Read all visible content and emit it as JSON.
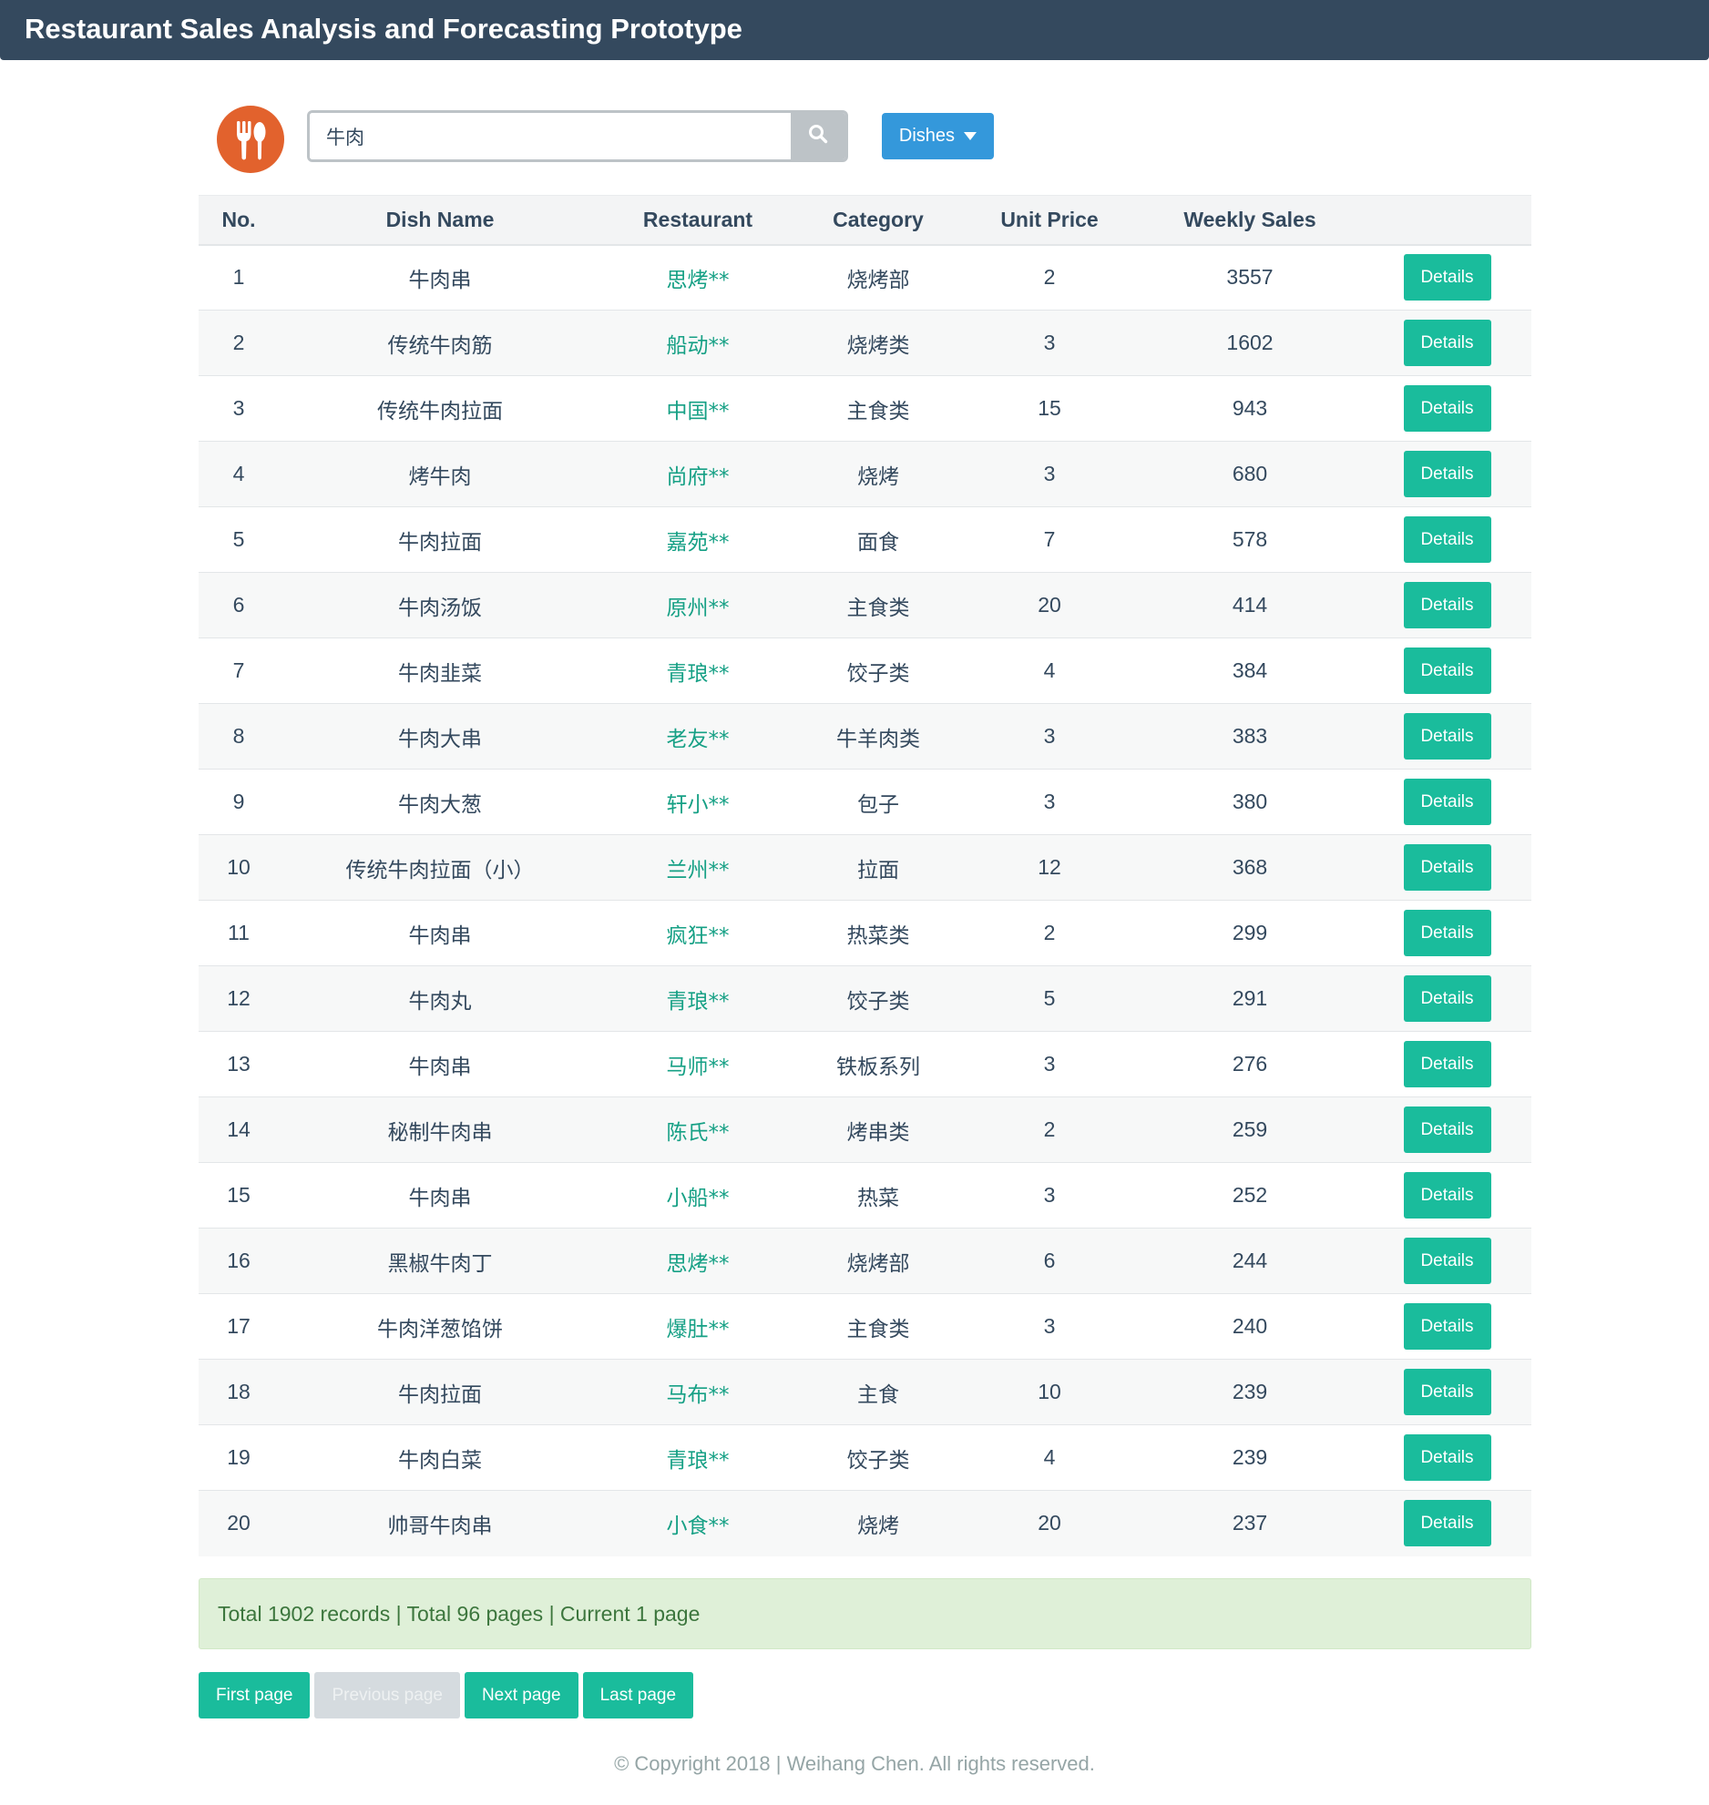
{
  "header": {
    "title": "Restaurant Sales Analysis and Forecasting Prototype"
  },
  "logo": {
    "icon": "fork-spoon-icon",
    "color": "#e2622d"
  },
  "search": {
    "value": "牛肉",
    "icon": "search-icon"
  },
  "filter": {
    "label": "Dishes",
    "icon": "caret-down-icon"
  },
  "table": {
    "columns": [
      "No.",
      "Dish Name",
      "Restaurant",
      "Category",
      "Unit Price",
      "Weekly Sales",
      ""
    ],
    "details_label": "Details",
    "rows": [
      {
        "no": "1",
        "dish": "牛肉串",
        "restaurant": "思烤**",
        "category": "烧烤部",
        "price": "2",
        "sales": "3557"
      },
      {
        "no": "2",
        "dish": "传统牛肉筋",
        "restaurant": "船动**",
        "category": "烧烤类",
        "price": "3",
        "sales": "1602"
      },
      {
        "no": "3",
        "dish": "传统牛肉拉面",
        "restaurant": "中国**",
        "category": "主食类",
        "price": "15",
        "sales": "943"
      },
      {
        "no": "4",
        "dish": "烤牛肉",
        "restaurant": "尚府**",
        "category": "烧烤",
        "price": "3",
        "sales": "680"
      },
      {
        "no": "5",
        "dish": "牛肉拉面",
        "restaurant": "嘉苑**",
        "category": "面食",
        "price": "7",
        "sales": "578"
      },
      {
        "no": "6",
        "dish": "牛肉汤饭",
        "restaurant": "原州**",
        "category": "主食类",
        "price": "20",
        "sales": "414"
      },
      {
        "no": "7",
        "dish": "牛肉韭菜",
        "restaurant": "青琅**",
        "category": "饺子类",
        "price": "4",
        "sales": "384"
      },
      {
        "no": "8",
        "dish": "牛肉大串",
        "restaurant": "老友**",
        "category": "牛羊肉类",
        "price": "3",
        "sales": "383"
      },
      {
        "no": "9",
        "dish": "牛肉大葱",
        "restaurant": "轩小**",
        "category": "包子",
        "price": "3",
        "sales": "380"
      },
      {
        "no": "10",
        "dish": "传统牛肉拉面（小）",
        "restaurant": "兰州**",
        "category": "拉面",
        "price": "12",
        "sales": "368"
      },
      {
        "no": "11",
        "dish": "牛肉串",
        "restaurant": "疯狂**",
        "category": "热菜类",
        "price": "2",
        "sales": "299"
      },
      {
        "no": "12",
        "dish": "牛肉丸",
        "restaurant": "青琅**",
        "category": "饺子类",
        "price": "5",
        "sales": "291"
      },
      {
        "no": "13",
        "dish": "牛肉串",
        "restaurant": "马师**",
        "category": "铁板系列",
        "price": "3",
        "sales": "276"
      },
      {
        "no": "14",
        "dish": "秘制牛肉串",
        "restaurant": "陈氏**",
        "category": "烤串类",
        "price": "2",
        "sales": "259"
      },
      {
        "no": "15",
        "dish": "牛肉串",
        "restaurant": "小船**",
        "category": "热菜",
        "price": "3",
        "sales": "252"
      },
      {
        "no": "16",
        "dish": "黑椒牛肉丁",
        "restaurant": "思烤**",
        "category": "烧烤部",
        "price": "6",
        "sales": "244"
      },
      {
        "no": "17",
        "dish": "牛肉洋葱馅饼",
        "restaurant": "爆肚**",
        "category": "主食类",
        "price": "3",
        "sales": "240"
      },
      {
        "no": "18",
        "dish": "牛肉拉面",
        "restaurant": "马布**",
        "category": "主食",
        "price": "10",
        "sales": "239"
      },
      {
        "no": "19",
        "dish": "牛肉白菜",
        "restaurant": "青琅**",
        "category": "饺子类",
        "price": "4",
        "sales": "239"
      },
      {
        "no": "20",
        "dish": "帅哥牛肉串",
        "restaurant": "小食**",
        "category": "烧烤",
        "price": "20",
        "sales": "237"
      }
    ]
  },
  "summary": {
    "text": "Total 1902 records | Total 96 pages | Current 1 page"
  },
  "pagination": {
    "first": "First page",
    "previous": "Previous page",
    "next": "Next page",
    "last": "Last page"
  },
  "footer": {
    "text": "© Copyright 2018  |  Weihang Chen. All rights reserved."
  },
  "colors": {
    "header_bg": "#34495e",
    "accent_green": "#1abc9c",
    "restaurant_text": "#16a085",
    "dropdown_blue": "#3498db",
    "summary_bg": "#dff0d8"
  }
}
